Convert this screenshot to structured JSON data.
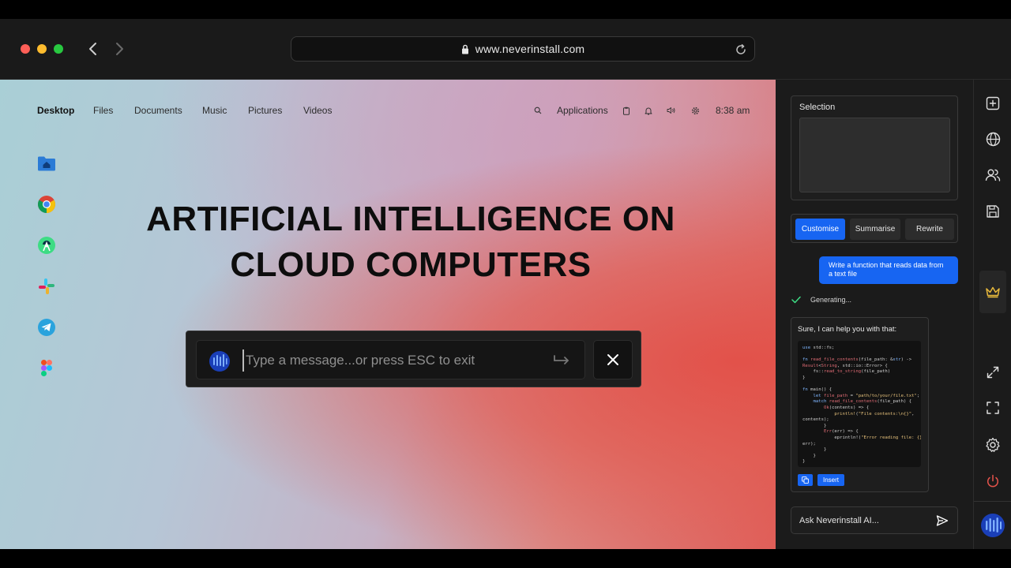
{
  "browser": {
    "url": "www.neverinstall.com"
  },
  "desktop": {
    "nav": {
      "items": [
        "Desktop",
        "Files",
        "Documents",
        "Music",
        "Pictures",
        "Videos"
      ],
      "active": "Desktop",
      "applications": "Applications",
      "time": "8:38 am"
    },
    "dock": [
      "home-folder-icon",
      "chrome-icon",
      "android-studio-icon",
      "slack-icon",
      "telegram-icon",
      "figma-icon"
    ],
    "headline": {
      "line1": "ARTIFICIAL INTELLIGENCE ON",
      "line2": "CLOUD COMPUTERS"
    },
    "ai_input": {
      "placeholder": "Type a message...or press ESC to exit",
      "value": ""
    }
  },
  "panel": {
    "selection_title": "Selection",
    "actions": {
      "customise": "Customise",
      "summarise": "Summarise",
      "rewrite": "Rewrite"
    },
    "user_message": "Write a function that reads data from a text file",
    "status": "Generating...",
    "answer_intro": "Sure, I can help you with that:",
    "insert_label": "Insert",
    "ask_placeholder": "Ask Neverinstall AI..."
  },
  "rail": [
    "new-tab-icon",
    "globe-icon",
    "users-icon",
    "save-icon",
    "crown-icon",
    "expand-icon",
    "fullscreen-icon",
    "settings-icon",
    "power-icon",
    "neverinstall-logo"
  ],
  "colors": {
    "accent_blue": "#1765f2",
    "panel_bg": "#1b1b1b",
    "power_red": "#e5534b",
    "crown_gold": "#e8b93b"
  }
}
